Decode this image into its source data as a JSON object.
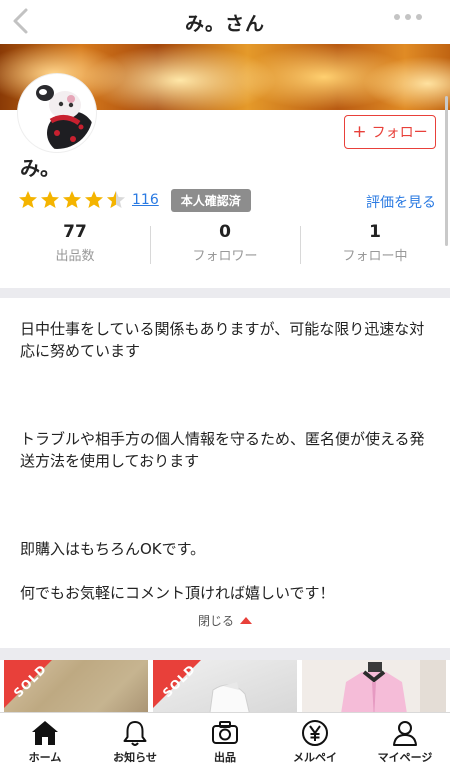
{
  "header": {
    "title": "み。さん"
  },
  "profile": {
    "name": "み。",
    "follow_label": "フォロー",
    "rating": {
      "stars": 4.5,
      "count": "116",
      "see_label": "評価を見る"
    },
    "badge": "本人確認済",
    "stats": [
      {
        "value": "77",
        "label": "出品数"
      },
      {
        "value": "0",
        "label": "フォロワー"
      },
      {
        "value": "1",
        "label": "フォロー中"
      }
    ]
  },
  "bio": {
    "paragraphs": [
      "日中仕事をしている関係もありますが、可能な限り迅速な対応に努めています",
      "トラブルや相手方の個人情報を守るため、匿名便が使える発送方法を使用しております",
      "即購入はもちろんOKです。",
      "何でもお気軽にコメント頂ければ嬉しいです！"
    ],
    "collapse_label": "閉じる"
  },
  "items": [
    {
      "sold": "SOLD"
    },
    {
      "sold": "SOLD"
    },
    {
      "sold": ""
    }
  ],
  "tabbar": [
    {
      "label": "ホーム",
      "icon": "home-icon"
    },
    {
      "label": "お知らせ",
      "icon": "bell-icon"
    },
    {
      "label": "出品",
      "icon": "camera-icon"
    },
    {
      "label": "メルペイ",
      "icon": "yen-icon"
    },
    {
      "label": "マイページ",
      "icon": "person-icon"
    }
  ],
  "colors": {
    "accent": "#e8403a",
    "link": "#2a7ae2",
    "star": "#f4b400"
  }
}
